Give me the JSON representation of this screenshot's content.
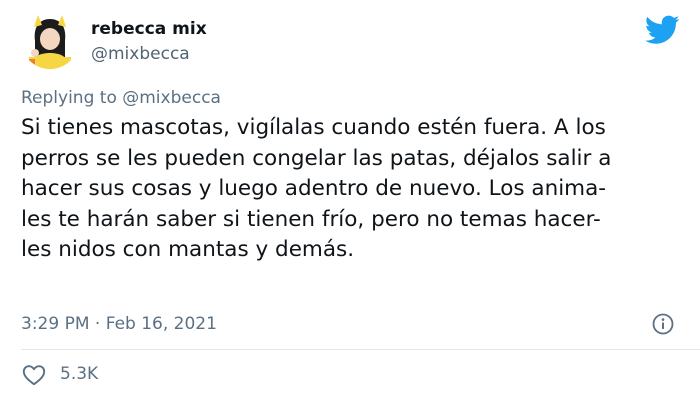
{
  "author": {
    "display_name": "rebecca mix",
    "handle": "@mixbecca"
  },
  "reply": {
    "prefix": "Replying to",
    "mention": "@mixbecca"
  },
  "tweet": {
    "lines": [
      "Si tienes mascotas, vigílalas cuando estén fuera. A los",
      "perros se les pueden congelar las patas, déjalos salir a",
      "hacer sus cosas y luego adentro de nuevo. Los anima-",
      "les te harán saber si tienen frío, pero no temas hacer-",
      "les nidos con mantas y demás."
    ]
  },
  "meta": {
    "time": "3:29 PM",
    "separator": "·",
    "date": "Feb 16, 2021"
  },
  "stats": {
    "likes": "5.3K"
  },
  "colors": {
    "brand": "#1da1f2",
    "text": "#0f1419",
    "secondary": "#5b7083",
    "divider": "#e1e8ed"
  },
  "icons": {
    "brand": "twitter-bird-icon",
    "info": "info-icon",
    "like": "heart-icon"
  }
}
